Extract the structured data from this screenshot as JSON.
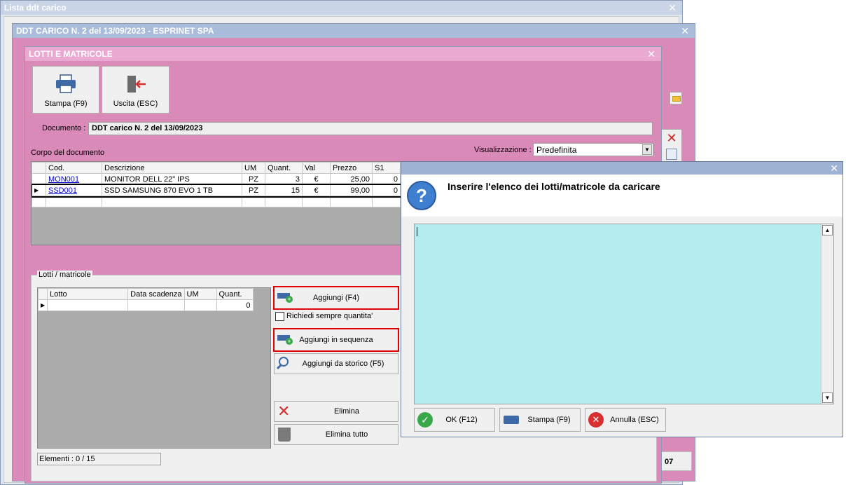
{
  "win1": {
    "title": "Lista ddt carico",
    "close": "✕"
  },
  "win2": {
    "title": "DDT CARICO N. 2 del 13/09/2023 - ESPRINET SPA",
    "close": "✕",
    "footer_right": "07"
  },
  "lotti": {
    "title": "LOTTI E MATRICOLE",
    "close": "✕",
    "toolbar": {
      "print_label": "Stampa (F9)",
      "exit_label": "Uscita (ESC)"
    },
    "documento_label": "Documento :",
    "documento_value": "DDT carico N. 2 del 13/09/2023",
    "corpo_label": "Corpo del documento",
    "visualizzazione_label": "Visualizzazione :",
    "visualizzazione_value": "Predefinita",
    "table": {
      "headers": [
        "Cod.",
        "Descrizione",
        "UM",
        "Quant.",
        "Val",
        "Prezzo",
        "S1"
      ],
      "rows": [
        {
          "cod": "MON001",
          "descr": "MONITOR DELL 22\" IPS",
          "um": "PZ",
          "quant": "3",
          "val": "€",
          "prezzo": "25,00",
          "s1": "0"
        },
        {
          "cod": "SSD001",
          "descr": "SSD SAMSUNG 870 EVO 1 TB",
          "um": "PZ",
          "quant": "15",
          "val": "€",
          "prezzo": "99,00",
          "s1": "0"
        }
      ]
    },
    "lotti_group_label": "Lotti / matricole",
    "lotti_table": {
      "headers": [
        "Lotto",
        "Data scadenza",
        "UM",
        "Quant."
      ],
      "row_quant": "0"
    },
    "buttons": {
      "aggiungi": "Aggiungi (F4)",
      "richiedi": "Richiedi sempre quantita'",
      "sequenza": "Aggiungi in sequenza",
      "storico": "Aggiungi da storico (F5)",
      "elimina": "Elimina",
      "elimina_tutto": "Elimina tutto"
    },
    "elementi": "Elementi : 0 / 15"
  },
  "dialog": {
    "close": "✕",
    "prompt": "Inserire l'elenco dei lotti/matricole da caricare",
    "text_value": "",
    "ok_label": "OK (F12)",
    "print_label": "Stampa (F9)",
    "cancel_label": "Annulla (ESC)"
  },
  "colors": {
    "pink": "#da8ab9",
    "titlebar_pink": "#e8a7cf",
    "title_blue": "#9eb3d4",
    "textarea": "#b3eded",
    "highlight": "#e00000"
  }
}
